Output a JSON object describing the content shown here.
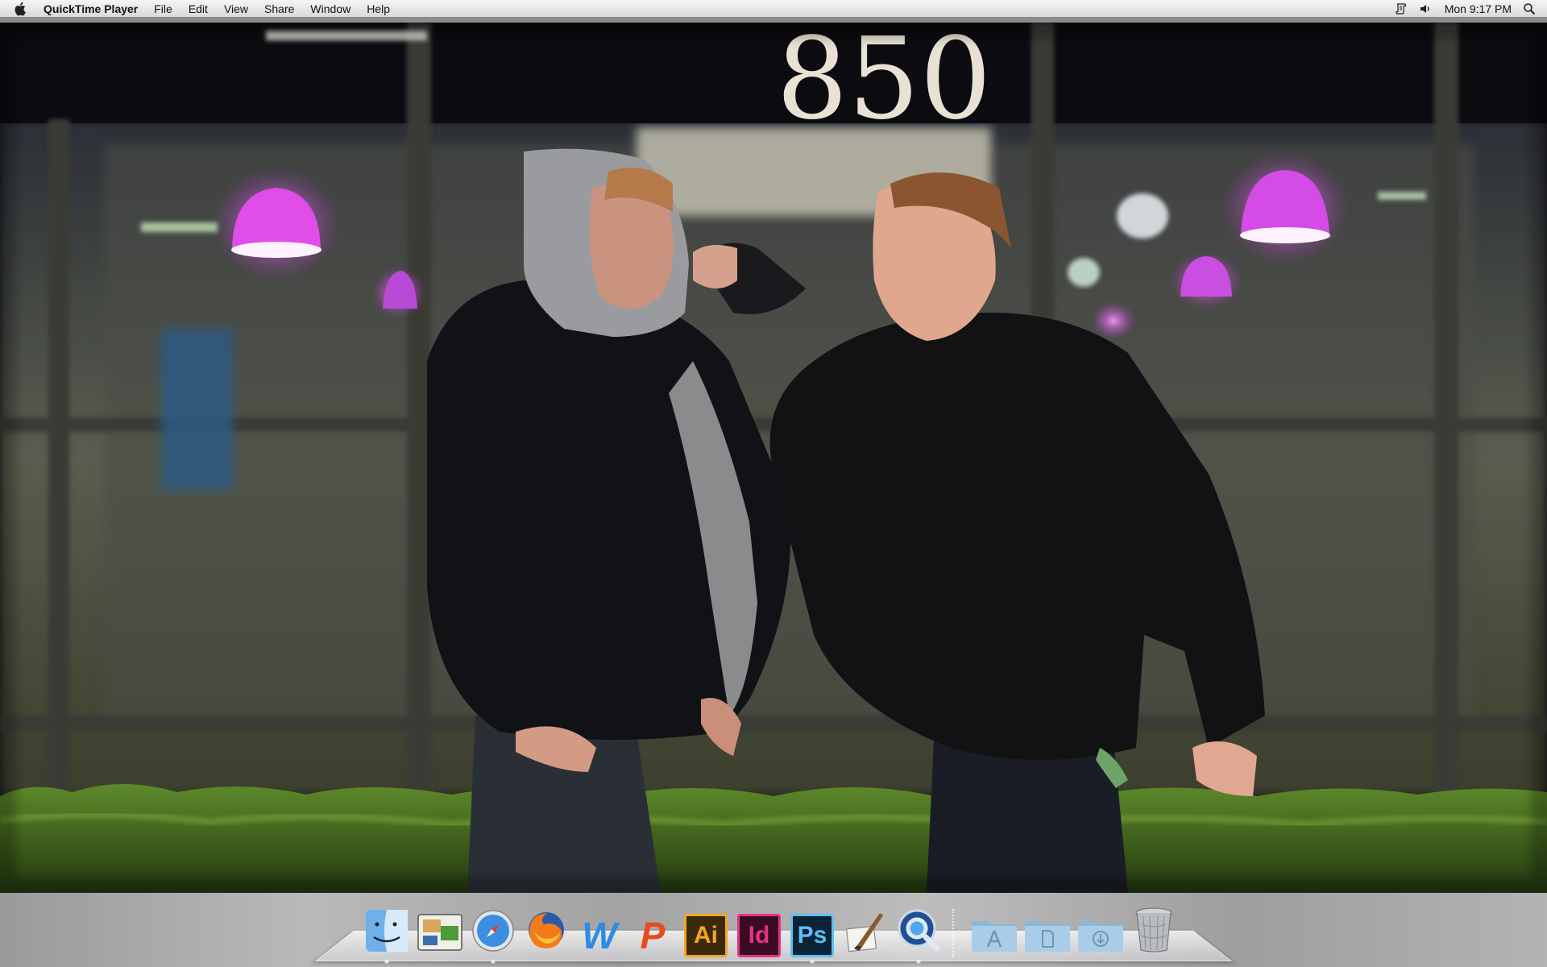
{
  "menubar": {
    "app_name": "QuickTime Player",
    "items": [
      "File",
      "Edit",
      "View",
      "Share",
      "Window",
      "Help"
    ],
    "clock": "Mon 9:17 PM"
  },
  "video": {
    "building_number": "850"
  },
  "dock": {
    "apps": [
      {
        "name": "Finder",
        "icon": "finder-icon",
        "running": true
      },
      {
        "name": "Preview",
        "icon": "preview-icon",
        "running": false
      },
      {
        "name": "Safari",
        "icon": "safari-icon",
        "running": true
      },
      {
        "name": "Firefox",
        "icon": "firefox-icon",
        "running": false
      },
      {
        "name": "Word",
        "icon": "word-icon",
        "label": "W",
        "running": false
      },
      {
        "name": "PowerPoint",
        "icon": "powerpoint-icon",
        "label": "P",
        "running": false
      },
      {
        "name": "Illustrator",
        "icon": "illustrator-icon",
        "label": "Ai",
        "running": false
      },
      {
        "name": "InDesign",
        "icon": "indesign-icon",
        "label": "Id",
        "running": false
      },
      {
        "name": "Photoshop",
        "icon": "photoshop-icon",
        "label": "Ps",
        "running": true
      },
      {
        "name": "Paintbrush",
        "icon": "paintbrush-icon",
        "running": false
      },
      {
        "name": "QuickTime Player",
        "icon": "quicktime-icon",
        "running": true
      }
    ],
    "stacks": [
      {
        "name": "Applications",
        "icon": "applications-folder-icon"
      },
      {
        "name": "Documents",
        "icon": "documents-folder-icon"
      },
      {
        "name": "Downloads",
        "icon": "downloads-folder-icon"
      }
    ],
    "trash": {
      "name": "Trash",
      "icon": "trash-icon"
    }
  },
  "colors": {
    "lamp_magenta": "#e040e8",
    "illustrator_orange": "#f7a51c",
    "indesign_pink": "#e6318b",
    "photoshop_blue": "#5bc0f0"
  }
}
